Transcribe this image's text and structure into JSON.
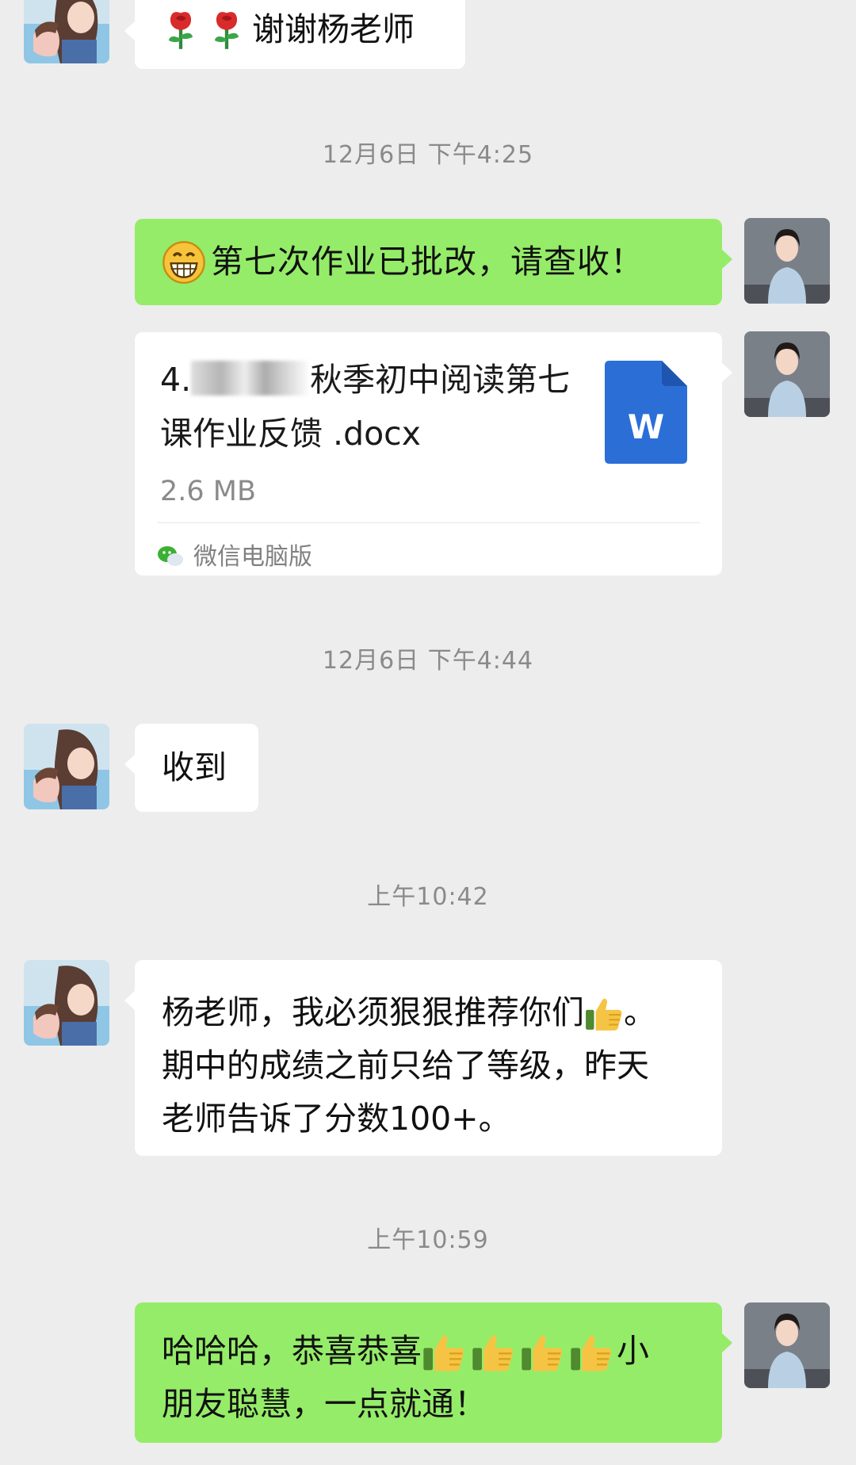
{
  "messages": {
    "m1": {
      "text": "谢谢杨老师",
      "emoji": [
        "rose",
        "rose"
      ]
    },
    "m2": {
      "text": "第七次作业已批改，请查收！",
      "emoji": "grinning-face"
    },
    "file": {
      "prefix": "4.",
      "name_rest": "秋季初中阅读第七课作业反馈 .docx",
      "size": "2.6 MB",
      "source": "微信电脑版",
      "icon_letter": "W"
    },
    "m3": {
      "text": "收到"
    },
    "m4": {
      "lines": [
        "杨老师，我必须狠狠推荐你们",
        "。",
        "期中的成绩之前只给了等级，昨天",
        "老师告诉了分数100+。"
      ]
    },
    "m5": {
      "line1_a": "哈哈哈，恭喜恭喜",
      "line1_b": "小",
      "line2": "朋友聪慧，一点就通！"
    }
  },
  "timestamps": {
    "t1": "12月6日 下午4:25",
    "t2": "12月6日 下午4:44",
    "t3": "上午10:42",
    "t4": "上午10:59"
  },
  "colors": {
    "background": "#ededed",
    "outgoing_bubble": "#95ec69",
    "incoming_bubble": "#ffffff",
    "word_icon": "#2b6fd6"
  }
}
